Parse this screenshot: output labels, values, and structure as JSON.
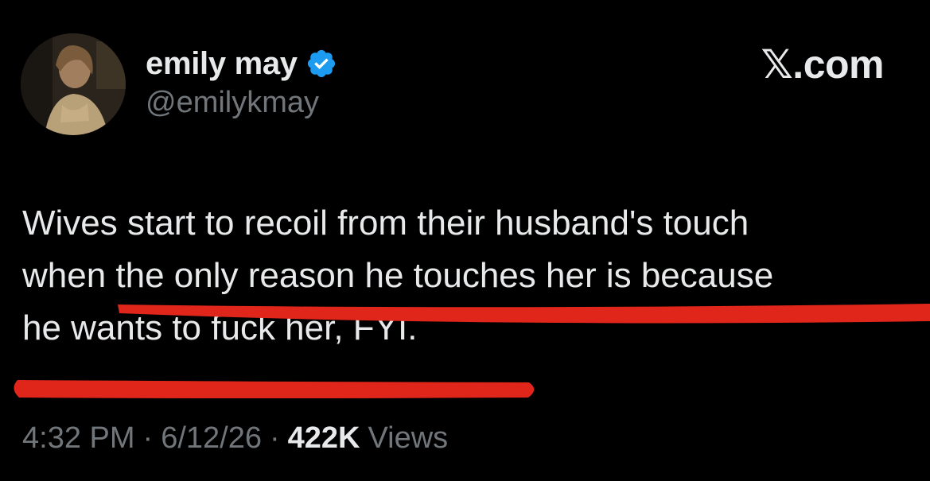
{
  "author": {
    "display_name": "emily may",
    "handle": "@emilykmay",
    "verified": true
  },
  "site": {
    "mark": "𝕏.com"
  },
  "tweet": {
    "text": "Wives start to recoil from their husband's touch\nwhen the only reason he touches her is because\nhe wants to fuck her, FYI."
  },
  "meta": {
    "time": "4:32 PM",
    "separator": "·",
    "date": "6/12/26",
    "views_count": "422K",
    "views_label": "Views"
  },
  "colors": {
    "background": "#000000",
    "text_primary": "#e7e9ea",
    "text_secondary": "#71767b",
    "verified_blue": "#1d9bf0",
    "annotation_red": "#e0261b"
  },
  "icons": {
    "verified": "verified-badge-icon",
    "avatar": "profile-photo"
  }
}
